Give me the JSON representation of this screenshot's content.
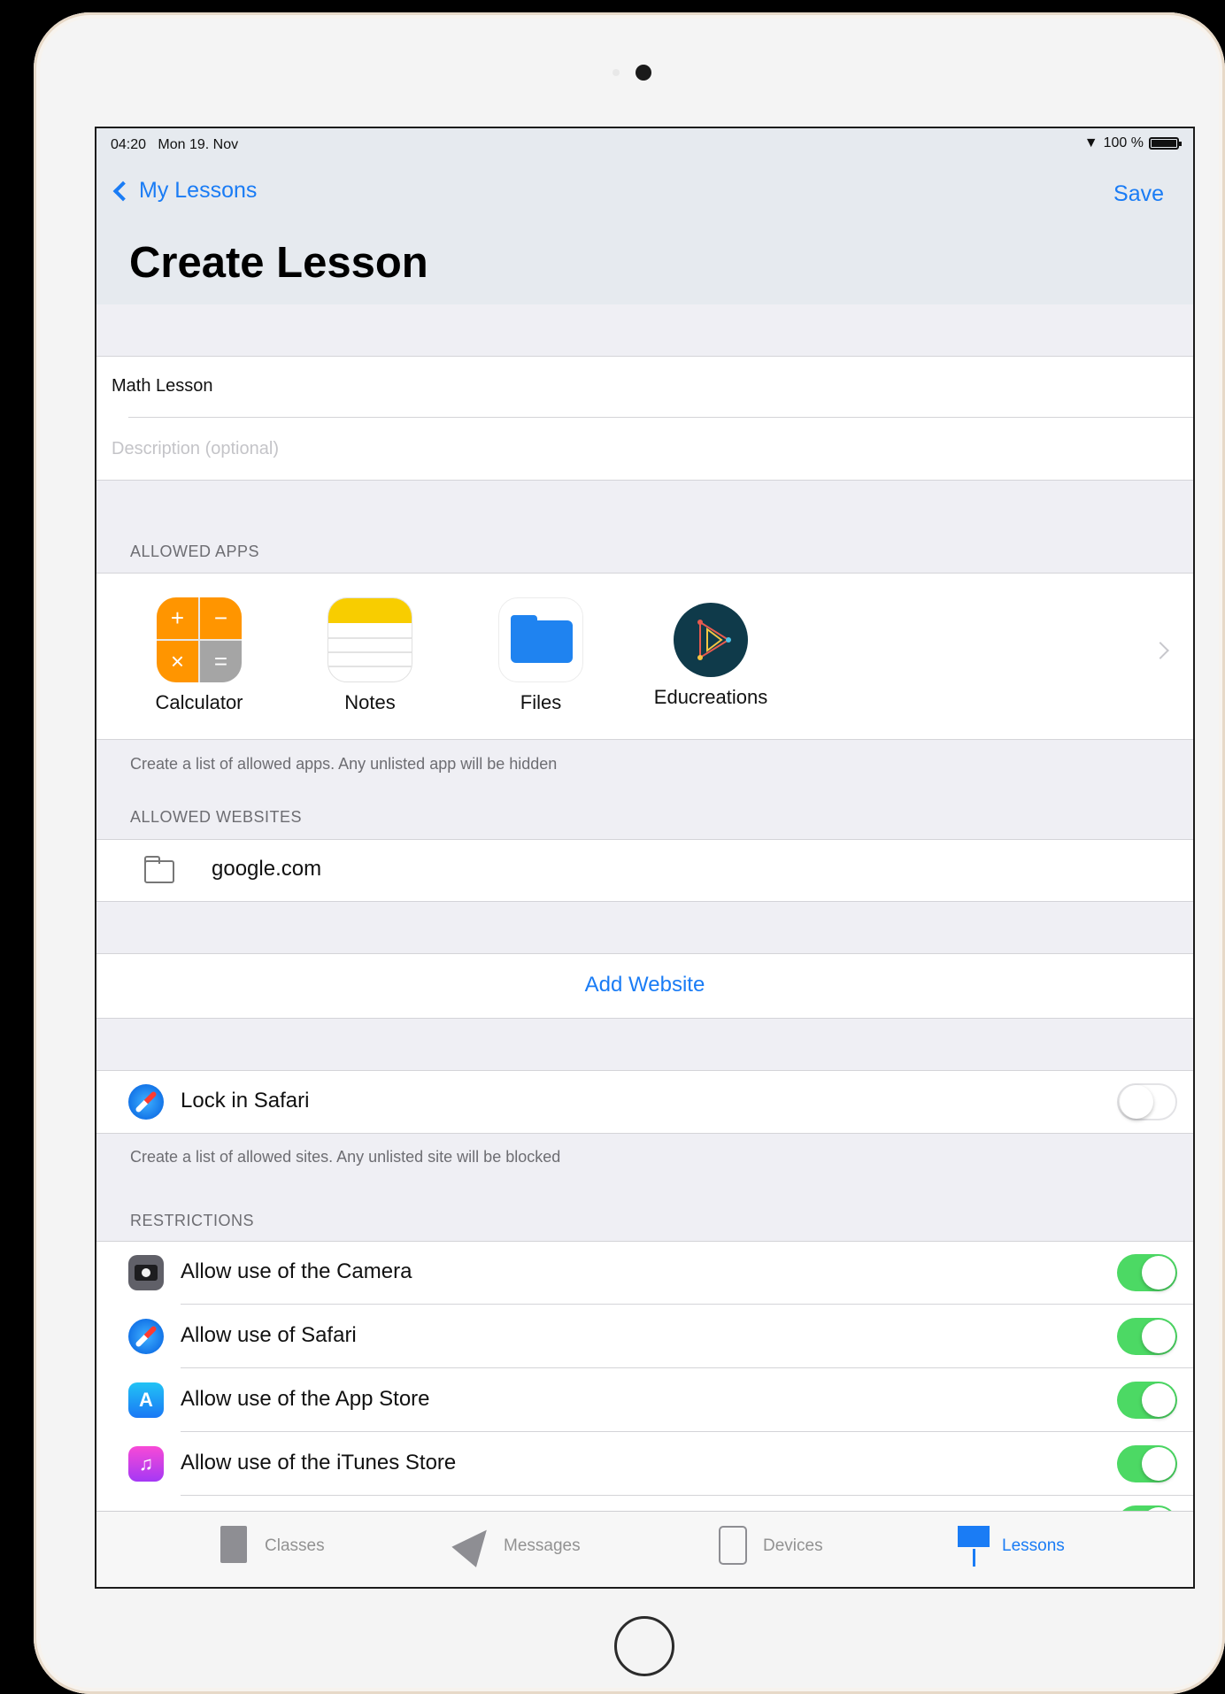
{
  "status_bar": {
    "time": "04:20",
    "date": "Mon 19. Nov",
    "battery": "100 %"
  },
  "nav": {
    "back_label": "My Lessons",
    "save_label": "Save",
    "title": "Create Lesson"
  },
  "form": {
    "name_value": "Math Lesson",
    "description_placeholder": "Description (optional)"
  },
  "allowed_apps": {
    "header": "ALLOWED APPS",
    "apps": [
      {
        "label": "Calculator",
        "icon": "calculator-icon"
      },
      {
        "label": "Notes",
        "icon": "notes-icon"
      },
      {
        "label": "Files",
        "icon": "files-icon"
      },
      {
        "label": "Educreations",
        "icon": "educreations-icon"
      }
    ],
    "footer": "Create a list of allowed apps. Any unlisted app will be hidden"
  },
  "allowed_websites": {
    "header": "ALLOWED WEBSITES",
    "sites": [
      "google.com"
    ],
    "add_label": "Add Website"
  },
  "lock_safari": {
    "label": "Lock in Safari",
    "enabled": false,
    "footer": "Create a list of allowed sites. Any unlisted site will be blocked"
  },
  "restrictions": {
    "header": "RESTRICTIONS",
    "items": [
      {
        "label": "Allow use of the Camera",
        "enabled": true
      },
      {
        "label": "Allow use of Safari",
        "enabled": true
      },
      {
        "label": "Allow use of the App Store",
        "enabled": true
      },
      {
        "label": "Allow use of the iTunes Store",
        "enabled": true
      }
    ]
  },
  "tabbar": {
    "tabs": [
      {
        "label": "Classes",
        "icon": "classes-icon"
      },
      {
        "label": "Messages",
        "icon": "megaphone-icon"
      },
      {
        "label": "Devices",
        "icon": "ipad-icon"
      },
      {
        "label": "Lessons",
        "icon": "presentation-icon",
        "active": true
      }
    ]
  },
  "colors": {
    "accent": "#1a7cf5",
    "toggle_on": "#4cd964",
    "nav_bg": "#e6eaef",
    "group_bg": "#efeff4"
  }
}
